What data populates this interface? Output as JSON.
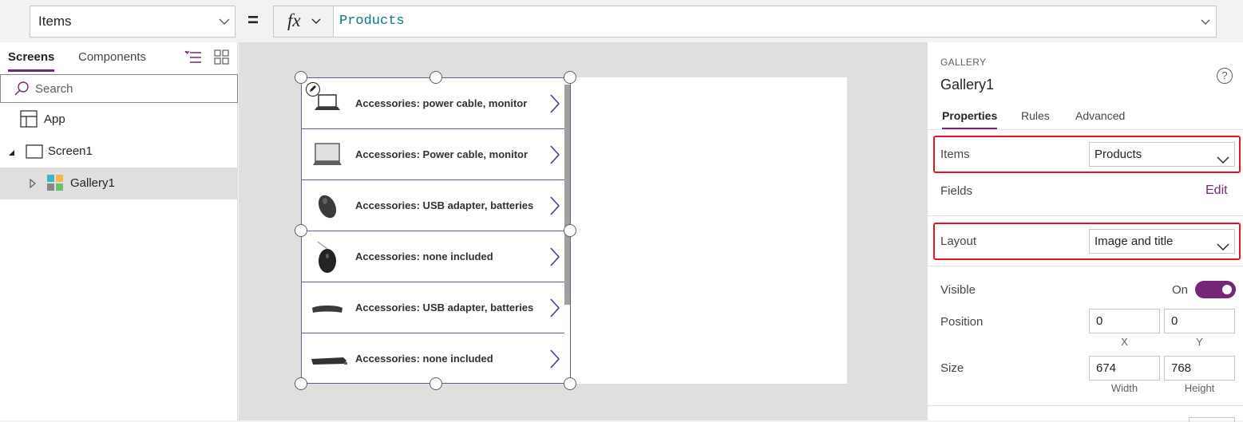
{
  "formula_bar": {
    "property": "Items",
    "equals": "=",
    "fx_label": "fx",
    "formula": "Products"
  },
  "left_panel": {
    "tabs": {
      "screens": "Screens",
      "components": "Components"
    },
    "search_placeholder": "Search",
    "tree": {
      "app": "App",
      "screen": "Screen1",
      "gallery": "Gallery1"
    }
  },
  "gallery": {
    "items": [
      {
        "title": "Accessories: power cable, monitor",
        "icon": "laptop-icon"
      },
      {
        "title": "Accessories: Power cable, monitor",
        "icon": "laptop-icon"
      },
      {
        "title": "Accessories: USB adapter, batteries",
        "icon": "mouse-icon"
      },
      {
        "title": "Accessories: none included",
        "icon": "mouse-icon"
      },
      {
        "title": "Accessories: USB adapter, batteries",
        "icon": "keyboard-icon"
      },
      {
        "title": "Accessories: none included",
        "icon": "keyboard-icon"
      }
    ]
  },
  "properties_panel": {
    "control_type": "GALLERY",
    "control_name": "Gallery1",
    "help": "?",
    "tabs": {
      "properties": "Properties",
      "rules": "Rules",
      "advanced": "Advanced"
    },
    "items_label": "Items",
    "items_value": "Products",
    "fields_label": "Fields",
    "fields_action": "Edit",
    "layout_label": "Layout",
    "layout_value": "Image and title",
    "visible_label": "Visible",
    "visible_value": "On",
    "position_label": "Position",
    "position_x": "0",
    "position_y": "0",
    "x_label": "X",
    "y_label": "Y",
    "size_label": "Size",
    "width": "674",
    "height": "768",
    "width_label": "Width",
    "height_label": "Height"
  },
  "colors": {
    "accent": "#742774",
    "highlight": "#e81123",
    "formula_text": "#0b7680"
  }
}
